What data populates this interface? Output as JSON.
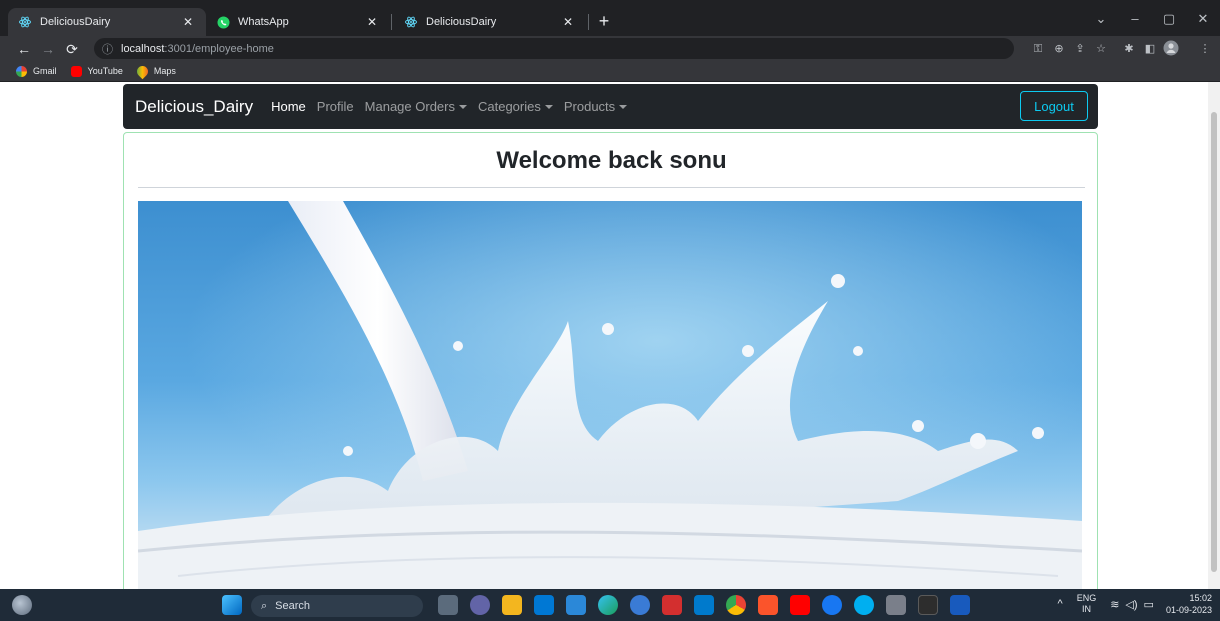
{
  "browser": {
    "tabs": [
      {
        "title": "DeliciousDairy",
        "favicon": "react-icon",
        "active": true
      },
      {
        "title": "WhatsApp",
        "favicon": "whatsapp-icon",
        "active": false
      },
      {
        "title": "DeliciousDairy",
        "favicon": "react-icon",
        "active": false
      }
    ],
    "url_host": "localhost",
    "url_path": ":3001/employee-home",
    "bookmarks": [
      {
        "label": "Gmail",
        "icon": "google-icon",
        "color": "#4285f4"
      },
      {
        "label": "YouTube",
        "icon": "youtube-icon",
        "color": "#ff0000"
      },
      {
        "label": "Maps",
        "icon": "maps-icon",
        "color": "#34a853"
      }
    ]
  },
  "app": {
    "brand": "Delicious_Dairy",
    "nav": {
      "home": "Home",
      "profile": "Profile",
      "manage_orders": "Manage Orders",
      "categories": "Categories",
      "products": "Products"
    },
    "logout": "Logout",
    "welcome": "Welcome back sonu",
    "hero_image": "milk-splash-image"
  },
  "taskbar": {
    "search": "Search",
    "lang_top": "ENG",
    "lang_bottom": "IN",
    "time": "15:02",
    "date": "01-09-2023"
  },
  "colors": {
    "navbar_bg": "#212529",
    "logout_accent": "#0dcaf0",
    "card_border": "#9fe2b2"
  }
}
